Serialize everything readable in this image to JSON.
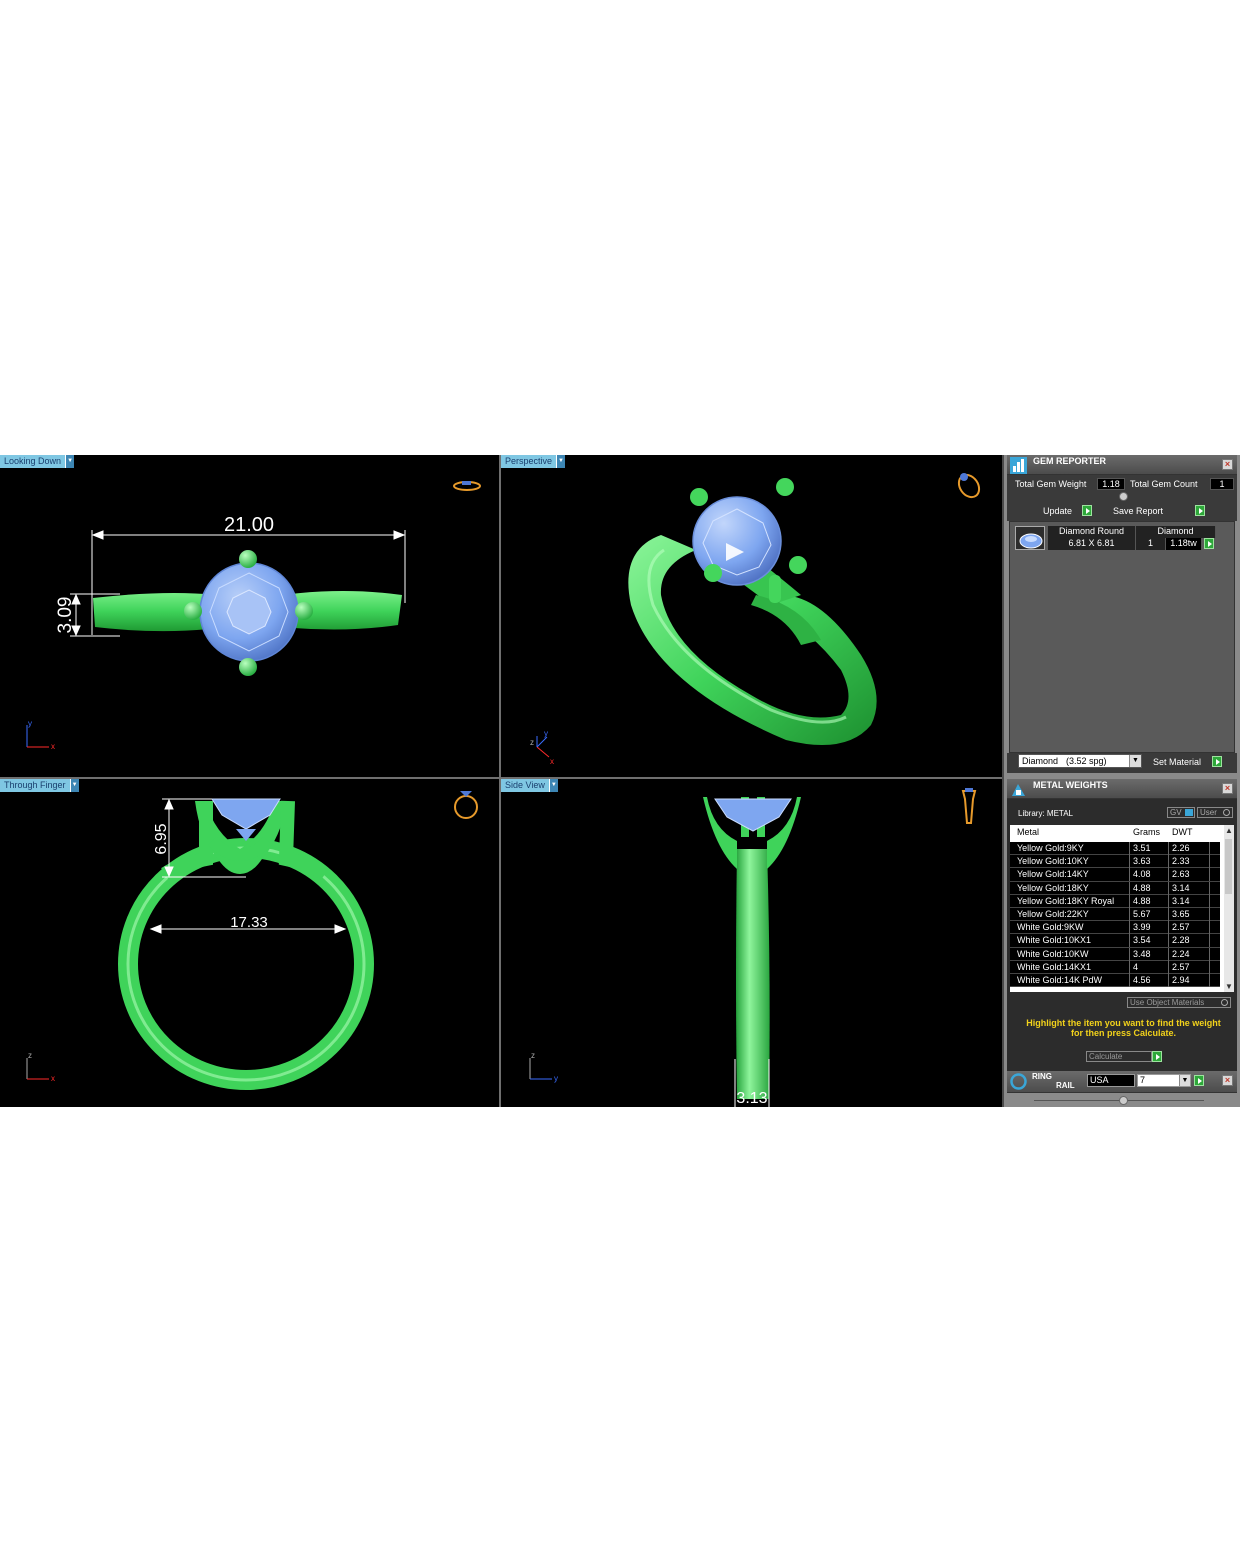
{
  "viewports": {
    "top_left": {
      "label": "Looking Down",
      "dim_width": "21.00",
      "dim_height": "3.09"
    },
    "top_right": {
      "label": "Perspective"
    },
    "bottom_left": {
      "label": "Through Finger",
      "dim_height": "6.95",
      "dim_inner": "17.33"
    },
    "bottom_right": {
      "label": "Side View",
      "dim_width": "3.13"
    }
  },
  "gem_reporter": {
    "title": "GEM REPORTER",
    "total_gem_weight_label": "Total Gem Weight",
    "total_gem_weight": "1.18",
    "total_gem_count_label": "Total Gem Count",
    "total_gem_count": "1",
    "update_label": "Update",
    "save_report_label": "Save Report",
    "gem_row": {
      "shape": "Diamond Round",
      "material": "Diamond",
      "size": "6.81 X 6.81",
      "count": "1",
      "weight": "1.18tw"
    },
    "material_select": "Diamond",
    "material_select_sg": "(3.52 spg)",
    "set_material_label": "Set Material"
  },
  "metal_weights": {
    "title": "METAL WEIGHTS",
    "library_label": "Library: METAL",
    "gv_label": "GV",
    "user_label": "User",
    "columns": {
      "metal": "Metal",
      "grams": "Grams",
      "dwt": "DWT"
    },
    "rows": [
      {
        "metal": "Yellow Gold:9KY",
        "grams": "3.51",
        "dwt": "2.26"
      },
      {
        "metal": "Yellow Gold:10KY",
        "grams": "3.63",
        "dwt": "2.33"
      },
      {
        "metal": "Yellow Gold:14KY",
        "grams": "4.08",
        "dwt": "2.63"
      },
      {
        "metal": "Yellow Gold:18KY",
        "grams": "4.88",
        "dwt": "3.14"
      },
      {
        "metal": "Yellow Gold:18KY Royal",
        "grams": "4.88",
        "dwt": "3.14"
      },
      {
        "metal": "Yellow Gold:22KY",
        "grams": "5.67",
        "dwt": "3.65"
      },
      {
        "metal": "White Gold:9KW",
        "grams": "3.99",
        "dwt": "2.57"
      },
      {
        "metal": "White Gold:10KX1",
        "grams": "3.54",
        "dwt": "2.28"
      },
      {
        "metal": "White Gold:10KW",
        "grams": "3.48",
        "dwt": "2.24"
      },
      {
        "metal": "White Gold:14KX1",
        "grams": "4",
        "dwt": "2.57"
      },
      {
        "metal": "White Gold:14K PdW",
        "grams": "4.56",
        "dwt": "2.94"
      }
    ],
    "use_object_materials": "Use Object Materials",
    "hint": "Highlight the item you want to find the weight for then press Calculate.",
    "calculate_label": "Calculate"
  },
  "ring_rail": {
    "title_1": "RING",
    "title_2": "RAIL",
    "country": "USA",
    "size": "7"
  },
  "colors": {
    "ring": "#3fd35a",
    "gem": "#7ea6f0",
    "tab": "#7fc7e3",
    "hint": "#f2d21b"
  }
}
